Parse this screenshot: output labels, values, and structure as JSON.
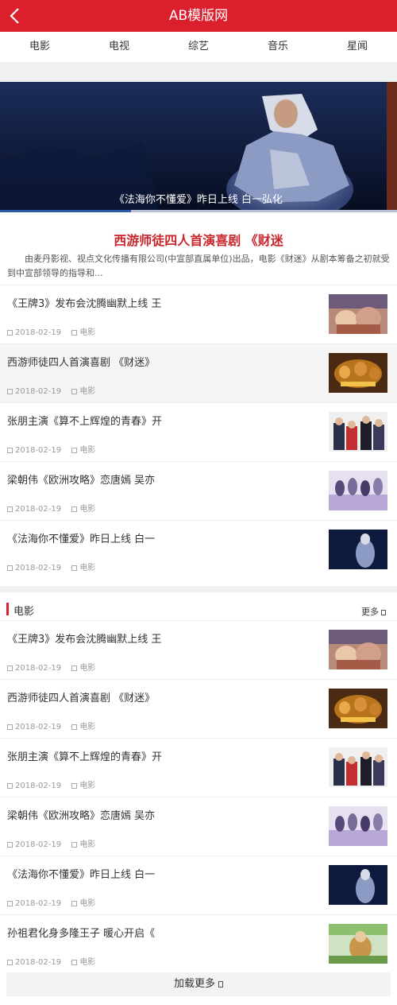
{
  "header": {
    "title": "AB模版网",
    "back_icon": "chevron-left-icon",
    "color": "#dc1f2d"
  },
  "nav": [
    "电影",
    "电视",
    "综艺",
    "音乐",
    "星闻"
  ],
  "banner": {
    "caption": "《法海你不懂爱》昨日上线 白一弘化",
    "progress": 0.33
  },
  "headline": {
    "title": "西游师徒四人首演喜剧 《财迷",
    "desc": "由麦丹影视、视点文化传播有限公司(中宣部直属单位)出品，电影《财迷》从剧本筹备之初就受到中宣部领导的指导和..."
  },
  "news": [
    {
      "title": "《王牌3》发布会沈腾幽默上线 王",
      "date": "2018-02-19",
      "cat": "电影"
    },
    {
      "title": "西游师徒四人首演喜剧 《财迷》",
      "date": "2018-02-19",
      "cat": "电影"
    },
    {
      "title": "张朋主演《算不上辉煌的青春》开",
      "date": "2018-02-19",
      "cat": "电影"
    },
    {
      "title": "梁朝伟《欧洲攻略》恋唐嫣 吴亦",
      "date": "2018-02-19",
      "cat": "电影"
    },
    {
      "title": "《法海你不懂爱》昨日上线 白一",
      "date": "2018-02-19",
      "cat": "电影"
    }
  ],
  "movie_section": {
    "title": "电影",
    "more": "更多",
    "items": [
      {
        "title": "《王牌3》发布会沈腾幽默上线 王",
        "date": "2018-02-19",
        "cat": "电影"
      },
      {
        "title": "西游师徒四人首演喜剧 《财迷》",
        "date": "2018-02-19",
        "cat": "电影"
      },
      {
        "title": "张朋主演《算不上辉煌的青春》开",
        "date": "2018-02-19",
        "cat": "电影"
      },
      {
        "title": "梁朝伟《欧洲攻略》恋唐嫣 吴亦",
        "date": "2018-02-19",
        "cat": "电影"
      },
      {
        "title": "《法海你不懂爱》昨日上线 白一",
        "date": "2018-02-19",
        "cat": "电影"
      },
      {
        "title": "孙祖君化身多隆王子 暖心开启《",
        "date": "2018-02-19",
        "cat": "电影"
      }
    ],
    "load_more": "加载更多"
  }
}
